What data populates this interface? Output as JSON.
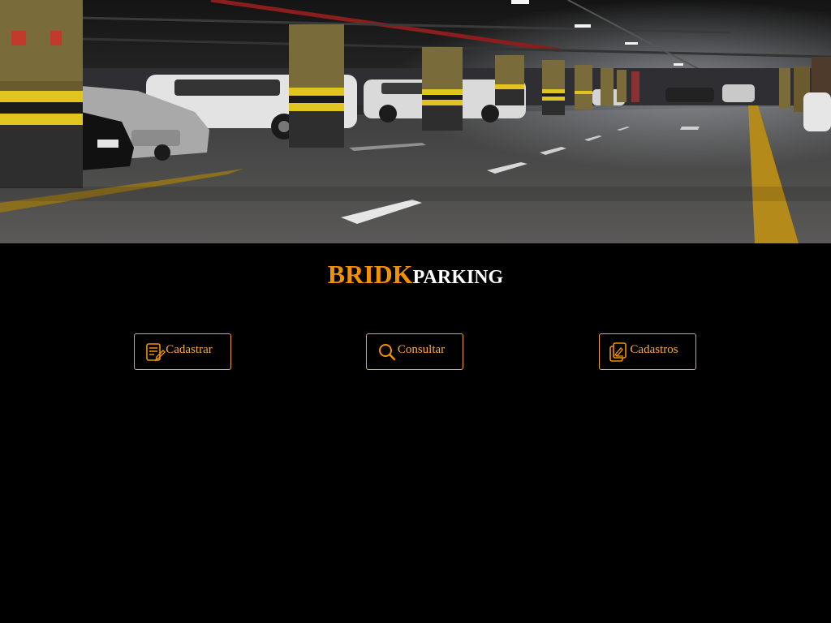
{
  "hero": {
    "image_name": "underground-parking-garage-photo"
  },
  "brand": {
    "part1": "BRIDK",
    "part2": "PARKING",
    "accent_color": "#f29100",
    "text_color": "#ffffff"
  },
  "actions": [
    {
      "label": "Cadastrar",
      "icon": "register-form-icon"
    },
    {
      "label": "Consultar",
      "icon": "search-icon"
    },
    {
      "label": "Cadastros",
      "icon": "records-list-icon"
    }
  ],
  "colors": {
    "background": "#000000",
    "button_border": "#f2a23a",
    "button_text": "#f7a94a"
  }
}
